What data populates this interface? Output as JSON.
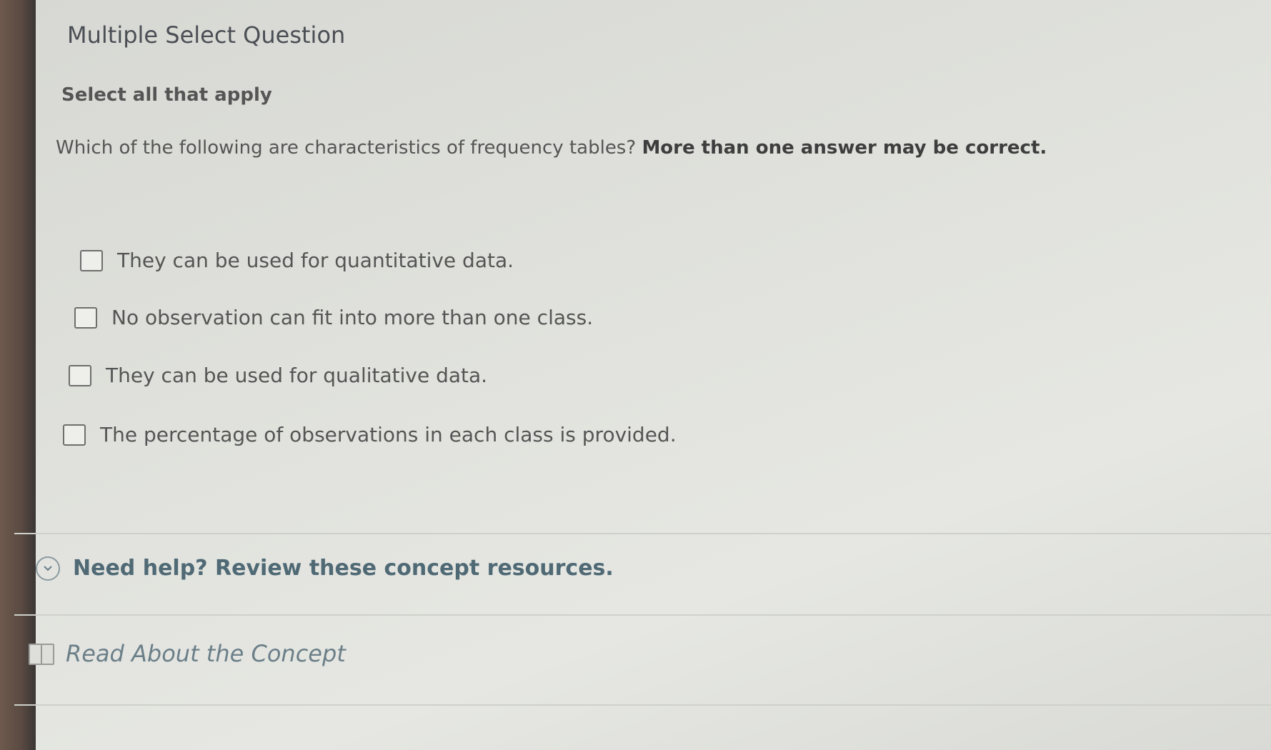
{
  "header": {
    "title": "Multiple Select Question",
    "instruction": "Select all that apply"
  },
  "question": {
    "text": "Which of the following are characteristics of frequency tables?",
    "emphasis": "More than one answer may be correct."
  },
  "options": [
    {
      "label": "They can be used for quantitative data.",
      "checked": false
    },
    {
      "label": "No observation can fit into more than one class.",
      "checked": false
    },
    {
      "label": "They can be used for qualitative data.",
      "checked": false
    },
    {
      "label": "The percentage of observations in each class is provided.",
      "checked": false
    }
  ],
  "help": {
    "icon": "chevron-down-circle-icon",
    "label": "Need help? Review these concept resources."
  },
  "resources": [
    {
      "icon": "book-icon",
      "label": "Read About the Concept"
    }
  ],
  "colors": {
    "accent": "#4f6975",
    "link": "#6b7f89"
  }
}
